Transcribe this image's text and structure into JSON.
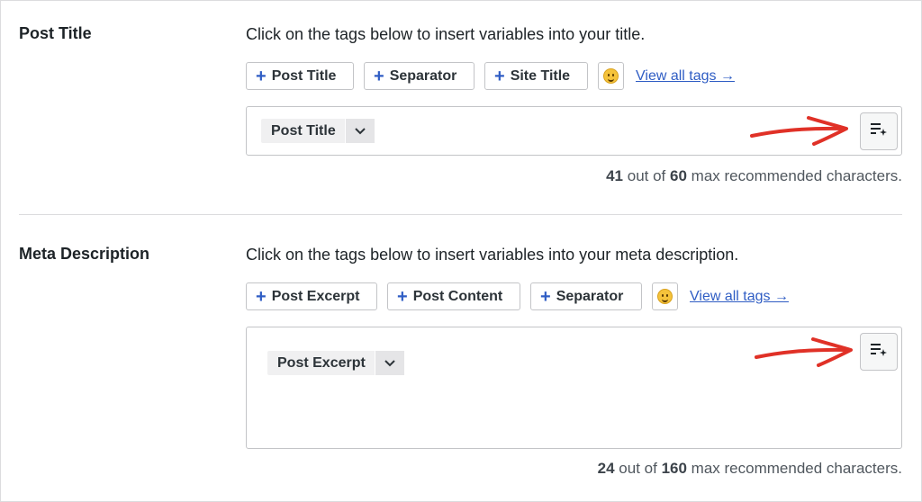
{
  "post_title_section": {
    "label": "Post Title",
    "description": "Click on the tags below to insert variables into your title.",
    "tags": [
      {
        "label": "Post Title"
      },
      {
        "label": "Separator"
      },
      {
        "label": "Site Title"
      }
    ],
    "view_all": "View all tags →",
    "editor_chip": "Post Title",
    "counter": {
      "current": "41",
      "middle": "out of",
      "max": "60",
      "suffix": "max recommended characters."
    }
  },
  "meta_description_section": {
    "label": "Meta Description",
    "description": "Click on the tags below to insert variables into your meta description.",
    "tags": [
      {
        "label": "Post Excerpt"
      },
      {
        "label": "Post Content"
      },
      {
        "label": "Separator"
      }
    ],
    "view_all": "View all tags →",
    "editor_chip": "Post Excerpt",
    "counter": {
      "current": "24",
      "middle": "out of",
      "max": "160",
      "suffix": "max recommended characters."
    }
  },
  "colors": {
    "accent_blue": "#2f5dc4",
    "annotation_red": "#e03127",
    "border": "#c3c4c7"
  },
  "icons": {
    "tag_plus": "plus-icon",
    "emoji": "smiley-emoji-icon",
    "chip_dropdown": "chevron-down-icon",
    "ai_generate": "ai-sparkle-list-icon",
    "annotation": "hand-drawn-arrow"
  }
}
